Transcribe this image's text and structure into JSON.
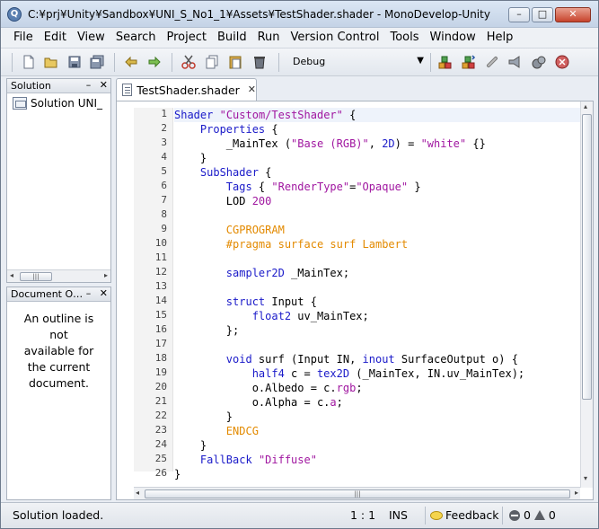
{
  "window": {
    "title": "C:¥prj¥Unity¥Sandbox¥UNI_S_No1_1¥Assets¥TestShader.shader - MonoDevelop-Unity",
    "app_icon_glyph": "Q",
    "controls": {
      "minimize": "–",
      "maximize": "□",
      "close": "✕"
    }
  },
  "menu": [
    "File",
    "Edit",
    "View",
    "Search",
    "Project",
    "Build",
    "Run",
    "Version Control",
    "Tools",
    "Window",
    "Help"
  ],
  "toolbar": {
    "configuration": "Debug",
    "icons": [
      "new-file-icon",
      "open-icon",
      "save-icon",
      "save-all-icon",
      "undo-icon",
      "redo-icon",
      "cut-icon",
      "copy-icon",
      "paste-icon",
      "delete-icon",
      "build-icon",
      "rebuild-icon",
      "attach-icon",
      "run-icon",
      "debug-icon",
      "stop-icon"
    ]
  },
  "solution_pad": {
    "title": "Solution",
    "item_label": "Solution UNI_",
    "buttons": {
      "minimize": "–",
      "close": "✕"
    },
    "scroll_arrow_left": "◂",
    "scroll_arrow_right": "▸",
    "scroll_grip": "|||"
  },
  "outline_pad": {
    "title": "Document O…",
    "message_lines": [
      "An outline is",
      "not",
      "available for",
      "the current",
      "document."
    ],
    "buttons": {
      "minimize": "–",
      "close": "✕"
    }
  },
  "editor": {
    "tab_label": "TestShader.shader",
    "tab_close": "✕",
    "line_numbers": [
      "1",
      "2",
      "3",
      "4",
      "5",
      "6",
      "7",
      "8",
      "9",
      "10",
      "11",
      "12",
      "13",
      "14",
      "15",
      "16",
      "17",
      "18",
      "19",
      "20",
      "21",
      "22",
      "23",
      "24",
      "25",
      "26"
    ],
    "scroll_up": "▴",
    "scroll_down": "▾",
    "scroll_left": "◂",
    "scroll_right": "▸",
    "scroll_grip": "|||"
  },
  "status": {
    "message": "Solution loaded.",
    "position": "1 : 1",
    "mode": "INS",
    "feedback": "Feedback",
    "errors": "0",
    "warnings": "0"
  },
  "colors": {
    "keyword": "#1a1ac9",
    "string": "#a016a0",
    "preprocessor": "#e38a00"
  }
}
